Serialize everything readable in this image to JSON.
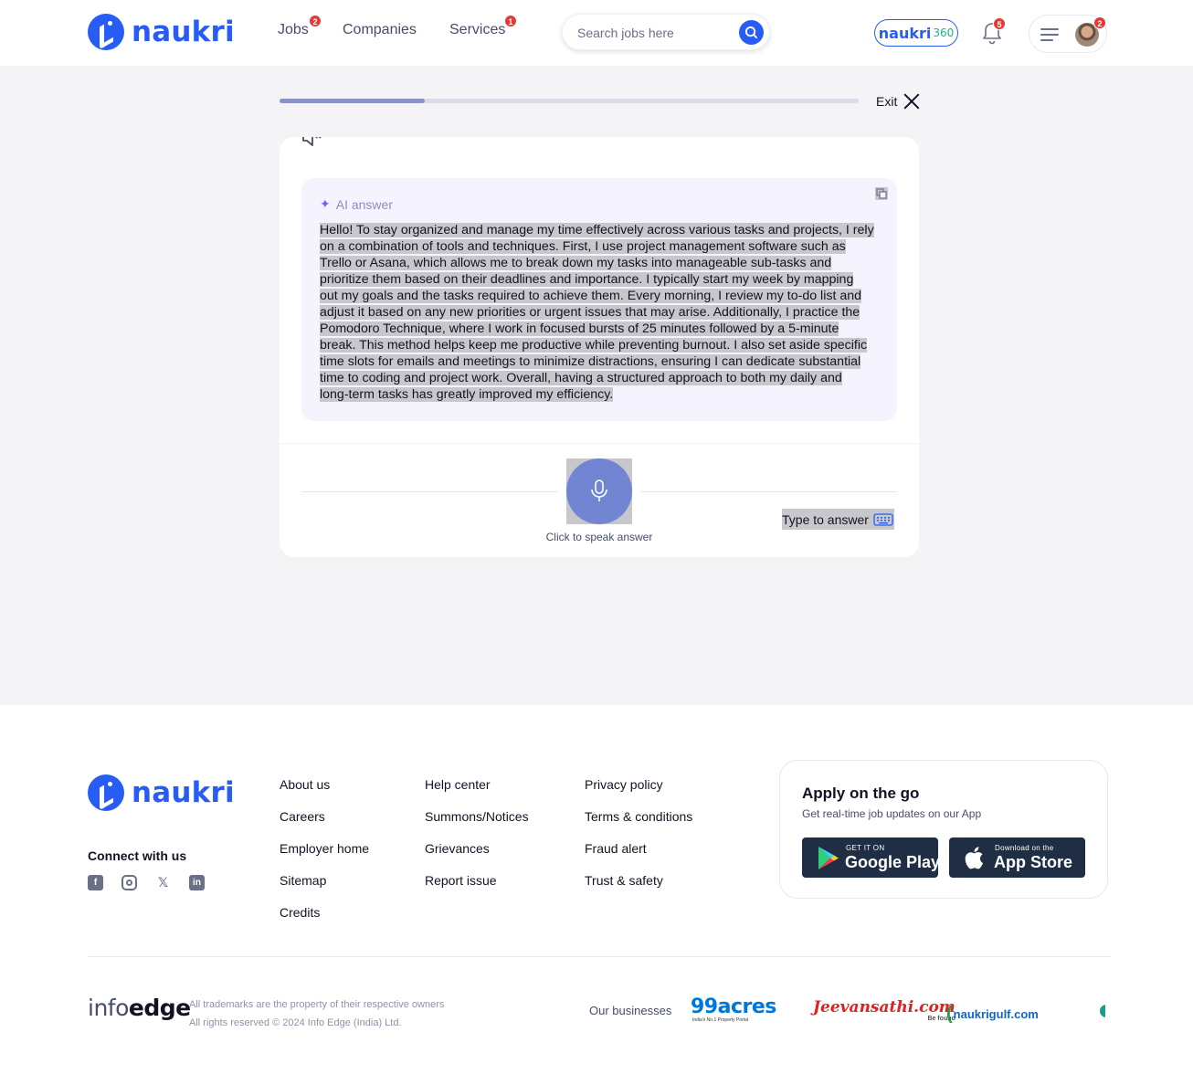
{
  "header": {
    "brand": "naukri",
    "nav": [
      {
        "label": "Jobs",
        "badge": "2"
      },
      {
        "label": "Companies",
        "badge": ""
      },
      {
        "label": "Services",
        "badge": "1"
      }
    ],
    "search_placeholder": "Search jobs here",
    "naukri360_brand": "naukri",
    "naukri360_num": "360",
    "notifications_badge": "5",
    "profile_badge": "2"
  },
  "quiz": {
    "progress_percent": 25,
    "exit_label": "Exit",
    "ai_label": "AI answer",
    "ai_answer_lines": [
      "Hello! To stay organized and manage my time effectively across various tasks and projects, I rely",
      "on a combination of tools and techniques. First, I use project management software such as",
      "Trello or Asana, which allows me to break down my tasks into manageable sub-tasks and",
      "prioritize them based on their deadlines and importance. I typically start my week by mapping",
      "out my goals and the tasks required to achieve them. Every morning, I review my to-do list and",
      "adjust it based on any new priorities or urgent issues that may arise. Additionally, I practice the",
      "Pomodoro Technique, where I work in focused bursts of 25 minutes followed by a 5-minute",
      "break. This method helps keep me productive while preventing burnout. I also set aside specific",
      "time slots for emails and meetings to minimize distractions, ensuring I can dedicate substantial",
      "time to coding and project work. Overall, having a structured approach to both my daily and",
      "long-term tasks has greatly improved my efficiency."
    ],
    "speak_label": "Click to speak answer",
    "type_label": "Type to answer"
  },
  "footer": {
    "brand": "naukri",
    "connect_label": "Connect with us",
    "col1": [
      "About us",
      "Careers",
      "Employer home",
      "Sitemap",
      "Credits"
    ],
    "col2": [
      "Help center",
      "Summons/Notices",
      "Grievances",
      "Report issue"
    ],
    "col3": [
      "Privacy policy",
      "Terms & conditions",
      "Fraud alert",
      "Trust & safety"
    ],
    "app_title": "Apply on the go",
    "app_sub": "Get real-time job updates on our App",
    "google_small": "GET IT ON",
    "google_big": "Google Play",
    "apple_small": "Download on the",
    "apple_big": "App Store",
    "infoedge_a": "info",
    "infoedge_b": "edge",
    "legal1": "All trademarks are the property of their respective owners",
    "legal2": "All rights reserved © 2024 Info Edge (India) Ltd.",
    "our_businesses": "Our businesses",
    "biz_99": "99acres",
    "biz_99_tag": "India's No.1 Property Portal",
    "biz_jeevan": "Jeevansathi.com",
    "biz_jeevan_tag": "Be found",
    "biz_gulf": "naukrigulf.com"
  }
}
